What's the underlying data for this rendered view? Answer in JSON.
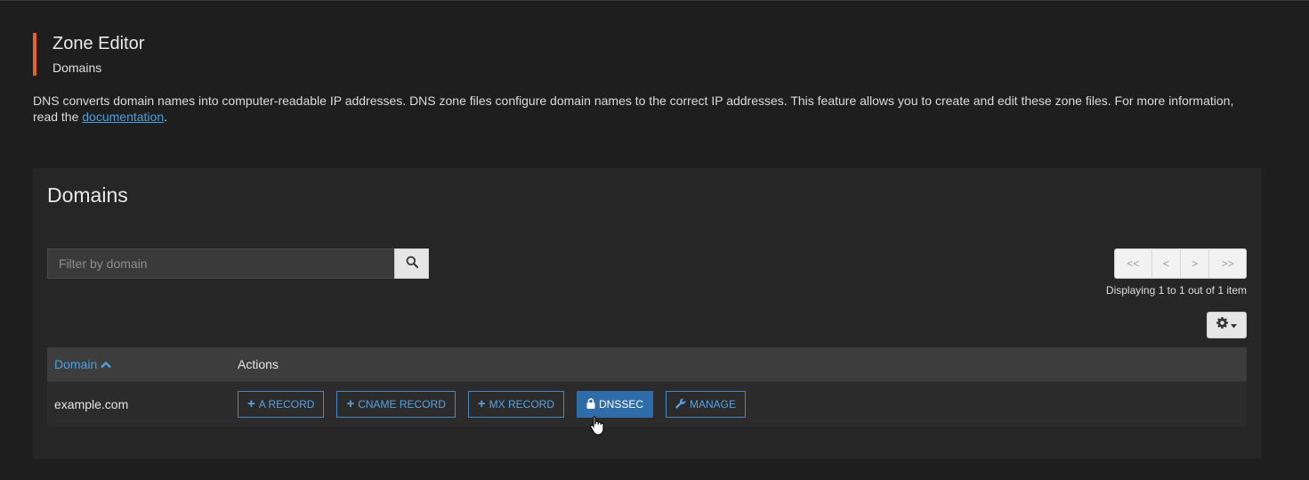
{
  "page": {
    "title": "Zone Editor",
    "subtitle": "Domains",
    "intro_text": "DNS converts domain names into computer-readable IP addresses. DNS zone files configure domain names to the correct IP addresses. This feature allows you to create and edit these zone files. For more information, read the ",
    "intro_link": "documentation",
    "intro_end": ".",
    "accent_color": "#e8632b"
  },
  "panel": {
    "title": "Domains",
    "search": {
      "placeholder": "Filter by domain",
      "value": "",
      "icon": "search-icon"
    },
    "pager": {
      "first": "<<",
      "prev": "<",
      "next": ">",
      "last": ">>",
      "info": "Displaying 1 to 1 out of 1 item"
    },
    "settings_icon": "gear-icon"
  },
  "table": {
    "columns": [
      "Domain",
      "Actions"
    ],
    "sort_icon": "chevron-up-icon",
    "rows": [
      {
        "domain": "example.com",
        "actions": {
          "a_record": "A RECORD",
          "cname_record": "CNAME RECORD",
          "mx_record": "MX RECORD",
          "dnssec": "DNSSEC",
          "manage": "MANAGE"
        }
      }
    ]
  },
  "colors": {
    "link": "#4a9fe0",
    "primary_button": "#2e6da9"
  }
}
